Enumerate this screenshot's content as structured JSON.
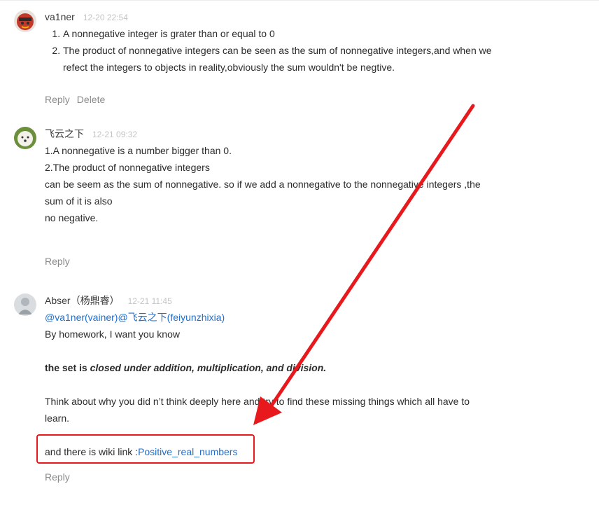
{
  "comments": [
    {
      "author": "va1ner",
      "time": "12-20 22:54",
      "list_items": [
        "A nonnegative integer is grater than or equal to 0",
        "The product of nonnegative integers can be seen as the sum of nonnegative integers,and when we",
        "refect the integers to objects in reality,obviously the sum wouldn't be negtive."
      ],
      "actions": {
        "reply": "Reply",
        "delete": "Delete"
      }
    },
    {
      "author": "飞云之下",
      "time": "12-21 09:32",
      "lines": [
        "1.A nonnegative is a number bigger than 0.",
        "2.The product of nonnegative integers",
        "can be seem as the sum of nonnegative. so if we add a nonnegative to the nonnegative integers ,the",
        "sum of it is also",
        "no negative."
      ],
      "actions": {
        "reply": "Reply"
      }
    },
    {
      "author": "Abser（杨鼎睿）",
      "time": "12-21 11:45",
      "mention": "@va1ner(vainer)@飞云之下(feiyunzhixia)",
      "line1": "By homework, I want you know",
      "bold_prefix": "the set is ",
      "bold_italic": "closed under addition, multiplication, and division.",
      "line3a": "Think about why you did n’t think deeply here and try to find these missing things which all have to",
      "line3b": "learn.",
      "wiki_prefix": "and there is wiki link :",
      "wiki_link": "Positive_real_numbers",
      "actions": {
        "reply": "Reply"
      }
    }
  ],
  "annotation": {
    "color": "#e8191c"
  }
}
